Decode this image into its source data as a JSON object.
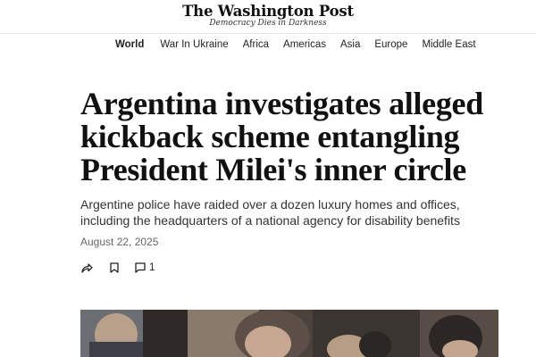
{
  "masthead": {
    "logo": "The Washington Post",
    "tagline": "Democracy Dies in Darkness"
  },
  "nav": {
    "items": [
      {
        "label": "World",
        "active": true
      },
      {
        "label": "War In Ukraine"
      },
      {
        "label": "Africa"
      },
      {
        "label": "Americas"
      },
      {
        "label": "Asia"
      },
      {
        "label": "Europe"
      },
      {
        "label": "Middle East"
      }
    ]
  },
  "article": {
    "headline_lines": [
      "Argentina investigates alleged",
      "kickback scheme entangling",
      "President Milei's inner circle"
    ],
    "deck_lines": [
      "Argentine police have raided over a dozen luxury homes and offices,",
      "including the headquarters of a national agency for disability benefits"
    ],
    "date": "August 22, 2025"
  },
  "actions": {
    "share_icon": "share-icon",
    "save_icon": "bookmark-icon",
    "comment_icon": "comment-icon",
    "comment_count": "1"
  },
  "colors": {
    "text": "#111111",
    "muted": "#666666",
    "divider": "#e6e6e6"
  }
}
